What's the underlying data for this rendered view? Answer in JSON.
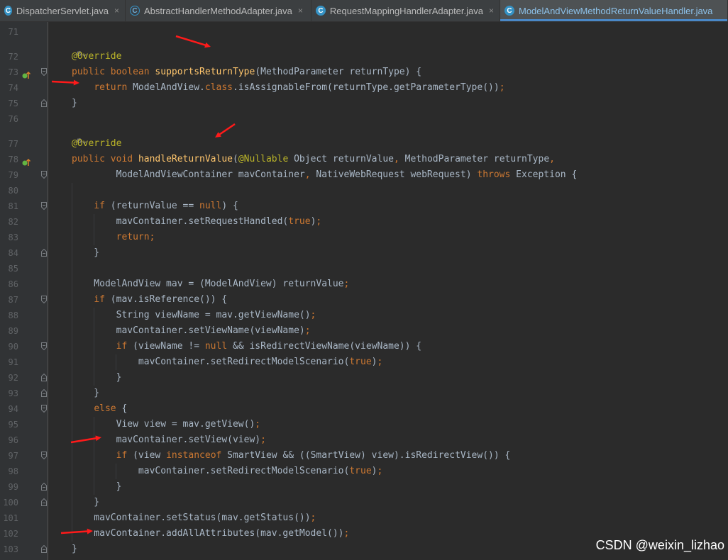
{
  "tabs": [
    {
      "label": "DispatcherServlet.java",
      "icon": "class-icon",
      "active": false,
      "width": 177
    },
    {
      "label": "AbstractHandlerMethodAdapter.java",
      "icon": "abstract-class-icon",
      "active": false,
      "width": 262
    },
    {
      "label": "RequestMappingHandlerAdapter.java",
      "icon": "class-icon",
      "active": false,
      "width": 266
    },
    {
      "label": "ModelAndViewMethodReturnValueHandler.java",
      "icon": "class-icon",
      "active": true,
      "width": 321
    }
  ],
  "tab_close_glyph": "×",
  "code_lines": [
    {
      "n": "71",
      "t": []
    },
    {
      "n": "72",
      "t": [
        [
          "an",
          "@Override"
        ]
      ]
    },
    {
      "n": "73",
      "gutter": "implementation-marker-icon",
      "fold": "start",
      "t": [
        [
          "kw",
          "public "
        ],
        [
          "kw",
          "boolean "
        ],
        [
          "fn",
          "supportsReturnType"
        ],
        [
          "",
          "(MethodParameter returnType) {"
        ]
      ]
    },
    {
      "n": "74",
      "t": [
        [
          "",
          "    "
        ],
        [
          "kw",
          "return "
        ],
        [
          "",
          "ModelAndView."
        ],
        [
          "kw",
          "class"
        ],
        [
          "",
          ".isAssignableFrom(returnType.getParameterType())"
        ],
        [
          "kw",
          ";"
        ]
      ]
    },
    {
      "n": "75",
      "fold": "end",
      "t": [
        [
          "",
          "}"
        ]
      ]
    },
    {
      "n": "76",
      "t": []
    },
    {
      "n": "77",
      "t": [
        [
          "an",
          "@Override"
        ]
      ]
    },
    {
      "n": "78",
      "gutter": "implementation-marker-icon",
      "t": [
        [
          "kw",
          "public "
        ],
        [
          "kw",
          "void "
        ],
        [
          "fn",
          "handleReturnValue"
        ],
        [
          "",
          "("
        ],
        [
          "an",
          "@Nullable "
        ],
        [
          "",
          "Object returnValue"
        ],
        [
          "kw",
          ", "
        ],
        [
          "",
          "MethodParameter returnType"
        ],
        [
          "kw",
          ","
        ]
      ]
    },
    {
      "n": "79",
      "fold": "start",
      "t": [
        [
          "",
          "        ModelAndViewContainer mavContainer"
        ],
        [
          "kw",
          ", "
        ],
        [
          "",
          "NativeWebRequest webRequest) "
        ],
        [
          "kw",
          "throws "
        ],
        [
          "",
          "Exception {"
        ]
      ]
    },
    {
      "n": "80",
      "t": []
    },
    {
      "n": "81",
      "fold": "start",
      "t": [
        [
          "",
          "    "
        ],
        [
          "kw",
          "if "
        ],
        [
          "",
          "(returnValue == "
        ],
        [
          "kw",
          "null"
        ],
        [
          "",
          ") {"
        ]
      ]
    },
    {
      "n": "82",
      "t": [
        [
          "",
          "        mavContainer.setRequestHandled("
        ],
        [
          "kw",
          "true"
        ],
        [
          "",
          ")"
        ],
        [
          "kw",
          ";"
        ]
      ]
    },
    {
      "n": "83",
      "t": [
        [
          "",
          "        "
        ],
        [
          "kw",
          "return;"
        ]
      ]
    },
    {
      "n": "84",
      "fold": "end",
      "t": [
        [
          "",
          "    }"
        ]
      ]
    },
    {
      "n": "85",
      "t": []
    },
    {
      "n": "86",
      "t": [
        [
          "",
          "    ModelAndView mav = (ModelAndView) returnValue"
        ],
        [
          "kw",
          ";"
        ]
      ]
    },
    {
      "n": "87",
      "fold": "start",
      "t": [
        [
          "",
          "    "
        ],
        [
          "kw",
          "if "
        ],
        [
          "",
          "(mav.isReference()) {"
        ]
      ]
    },
    {
      "n": "88",
      "t": [
        [
          "",
          "        String viewName = mav.getViewName()"
        ],
        [
          "kw",
          ";"
        ]
      ]
    },
    {
      "n": "89",
      "t": [
        [
          "",
          "        mavContainer.setViewName(viewName)"
        ],
        [
          "kw",
          ";"
        ]
      ]
    },
    {
      "n": "90",
      "fold": "start",
      "t": [
        [
          "",
          "        "
        ],
        [
          "kw",
          "if "
        ],
        [
          "",
          "(viewName != "
        ],
        [
          "kw",
          "null "
        ],
        [
          "",
          "&& isRedirectViewName(viewName)) {"
        ]
      ]
    },
    {
      "n": "91",
      "t": [
        [
          "",
          "            mavContainer.setRedirectModelScenario("
        ],
        [
          "kw",
          "true"
        ],
        [
          "",
          ")"
        ],
        [
          "kw",
          ";"
        ]
      ]
    },
    {
      "n": "92",
      "fold": "end",
      "t": [
        [
          "",
          "        }"
        ]
      ]
    },
    {
      "n": "93",
      "fold": "end",
      "t": [
        [
          "",
          "    }"
        ]
      ]
    },
    {
      "n": "94",
      "fold": "start",
      "t": [
        [
          "",
          "    "
        ],
        [
          "kw",
          "else "
        ],
        [
          "",
          "{"
        ]
      ]
    },
    {
      "n": "95",
      "t": [
        [
          "",
          "        View view = mav.getView()"
        ],
        [
          "kw",
          ";"
        ]
      ]
    },
    {
      "n": "96",
      "t": [
        [
          "",
          "        mavContainer.setView(view)"
        ],
        [
          "kw",
          ";"
        ]
      ]
    },
    {
      "n": "97",
      "fold": "start",
      "t": [
        [
          "",
          "        "
        ],
        [
          "kw",
          "if "
        ],
        [
          "",
          "(view "
        ],
        [
          "kw",
          "instanceof "
        ],
        [
          "",
          "SmartView && ((SmartView) view).isRedirectView()) {"
        ]
      ]
    },
    {
      "n": "98",
      "t": [
        [
          "",
          "            mavContainer.setRedirectModelScenario("
        ],
        [
          "kw",
          "true"
        ],
        [
          "",
          ")"
        ],
        [
          "kw",
          ";"
        ]
      ]
    },
    {
      "n": "99",
      "fold": "end",
      "t": [
        [
          "",
          "        }"
        ]
      ]
    },
    {
      "n": "100",
      "fold": "end",
      "t": [
        [
          "",
          "    }"
        ]
      ]
    },
    {
      "n": "101",
      "t": [
        [
          "",
          "    mavContainer.setStatus(mav.getStatus())"
        ],
        [
          "kw",
          ";"
        ]
      ]
    },
    {
      "n": "102",
      "t": [
        [
          "",
          "    mavContainer.addAllAttributes(mav.getModel())"
        ],
        [
          "kw",
          ";"
        ]
      ]
    },
    {
      "n": "103",
      "fold": "end",
      "t": [
        [
          "",
          "}"
        ]
      ]
    }
  ],
  "inlay_hint_glyph": "⚙⌄",
  "watermark": "CSDN @weixin_lizhao",
  "colors": {
    "keyword": "#cc7832",
    "annotation": "#bbb529",
    "method": "#ffc66d",
    "text": "#a9b7c6",
    "arrow": "#ff1a1a"
  }
}
